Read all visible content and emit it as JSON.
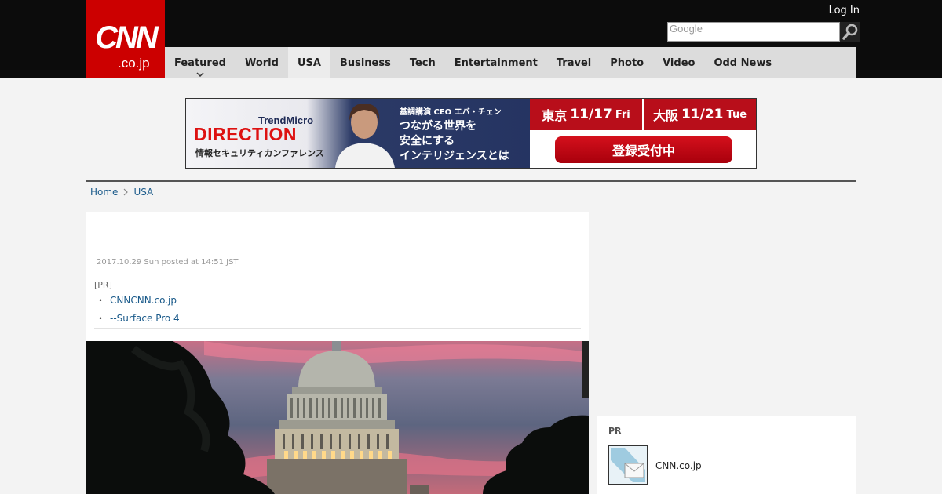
{
  "header": {
    "logo": {
      "main": "CNN",
      "domain": ".co.jp"
    },
    "login_label": "Log In",
    "search": {
      "placeholder": "Google",
      "icon": "search-icon"
    },
    "nav": [
      {
        "label": "Featured",
        "has_dropdown": true
      },
      {
        "label": "World"
      },
      {
        "label": "USA",
        "active": true
      },
      {
        "label": "Business"
      },
      {
        "label": "Tech"
      },
      {
        "label": "Entertainment"
      },
      {
        "label": "Travel"
      },
      {
        "label": "Photo"
      },
      {
        "label": "Video"
      },
      {
        "label": "Odd News"
      }
    ]
  },
  "ad": {
    "brand": "TrendMicro",
    "title": "DIRECTION",
    "subtitle": "情報セキュリティカンファレンス",
    "keynote": "基調講演 CEO エバ・チェン",
    "headline_line1": "つながる世界を",
    "headline_line2": "安全にする",
    "headline_line3": "インテリジェンスとは",
    "tokyo": {
      "city": "東京",
      "date": "11/17",
      "day": "Fri"
    },
    "osaka": {
      "city": "大阪",
      "date": "11/21",
      "day": "Tue"
    },
    "cta": "登録受付中",
    "colors": {
      "red": "#b80e1a",
      "navy": "#253462"
    }
  },
  "breadcrumb": {
    "home": "Home",
    "section": "USA"
  },
  "article": {
    "date": "2017.10.29 Sun posted at 14:51 JST",
    "pr_label": "[PR]",
    "pr_links": [
      "CNNCNN.co.jp",
      "--Surface Pro 4"
    ]
  },
  "sidebar": {
    "title": "PR",
    "item_text": "CNN.co.jp"
  },
  "colors": {
    "brand_red": "#cc0000",
    "header_bg": "#0c0c0c",
    "nav_bg": "#dcdcdc",
    "link": "#1a5a8a"
  }
}
